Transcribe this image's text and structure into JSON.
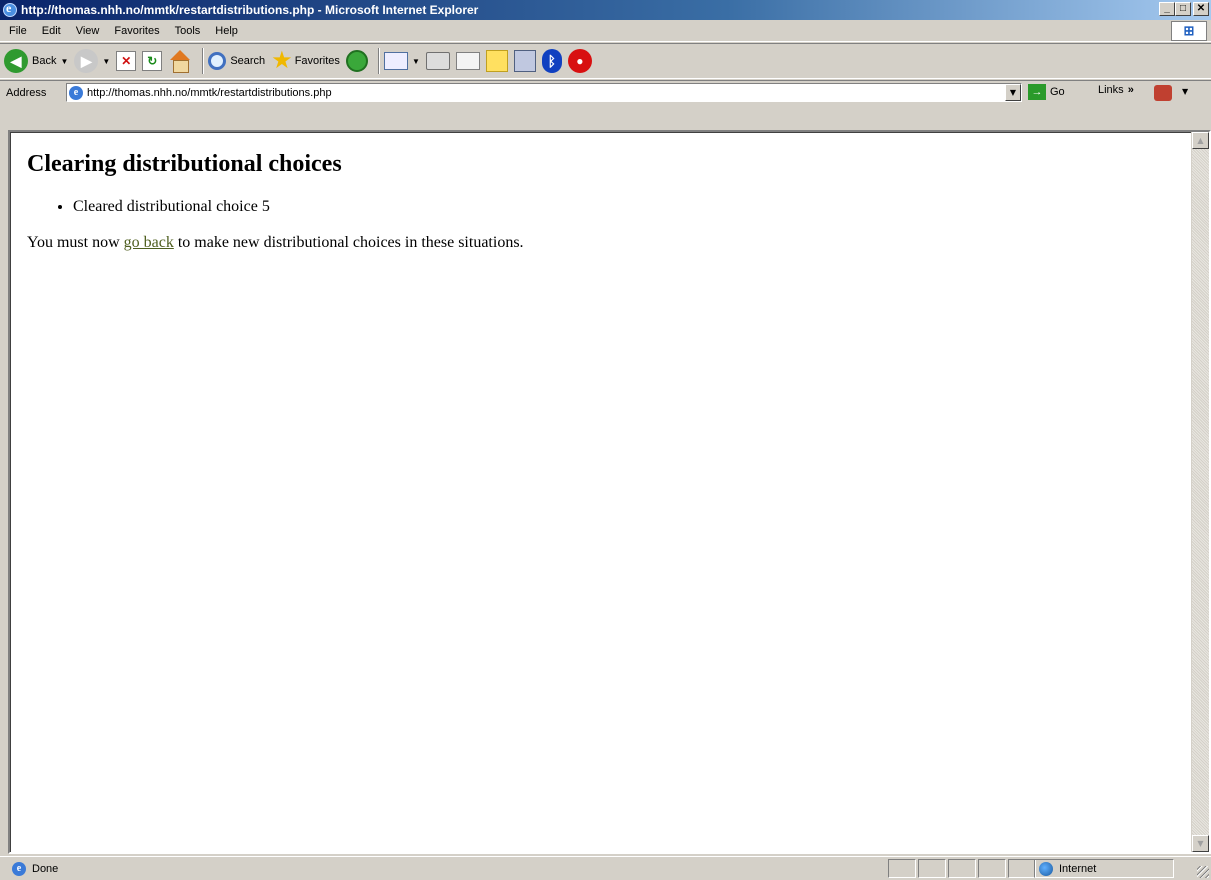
{
  "window": {
    "title": "http://thomas.nhh.no/mmtk/restartdistributions.php - Microsoft Internet Explorer",
    "minimize_label": "_",
    "maximize_label": "□",
    "close_label": "✕"
  },
  "menu": [
    {
      "label": "File"
    },
    {
      "label": "Edit"
    },
    {
      "label": "View"
    },
    {
      "label": "Favorites"
    },
    {
      "label": "Tools"
    },
    {
      "label": "Help"
    }
  ],
  "toolbar": {
    "back_label": "Back",
    "search_label": "Search",
    "favorites_label": "Favorites",
    "icons": [
      "back-icon",
      "forward-icon",
      "stop-icon",
      "refresh-icon",
      "home-icon",
      "search-icon",
      "favorites-star-icon",
      "history-icon",
      "mail-icon",
      "print-icon",
      "edit-icon",
      "notes-icon",
      "research-icon",
      "bluetooth-icon",
      "messenger-icon"
    ]
  },
  "address": {
    "label": "Address",
    "url": "http://thomas.nhh.no/mmtk/restartdistributions.php",
    "go_label": "Go",
    "links_label": "Links"
  },
  "page": {
    "heading": "Clearing distributional choices",
    "items": [
      "Cleared distributional choice 5"
    ],
    "paragraph_before": "You must now ",
    "link_text": "go back",
    "paragraph_after": " to make new distributional choices in these situations."
  },
  "status": {
    "text": "Done",
    "zone": "Internet"
  },
  "colors": {
    "titlebar_start": "#0a246a",
    "titlebar_end": "#a6caf0",
    "chrome": "#d4d0c8",
    "link": "#4f5f1f"
  }
}
